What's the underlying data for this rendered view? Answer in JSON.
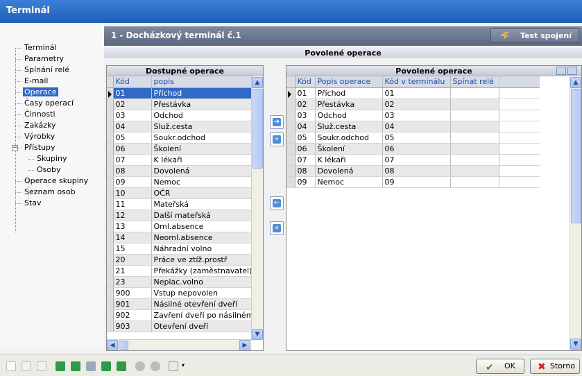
{
  "window": {
    "title": "Terminál"
  },
  "header": {
    "title": "1  -  Docházkový terminál č.1",
    "test_button": "Test spojení"
  },
  "section_title": "Povolené operace",
  "tree": [
    {
      "label": "Terminál",
      "level": 0
    },
    {
      "label": "Parametry",
      "level": 0
    },
    {
      "label": "Spínání relé",
      "level": 0
    },
    {
      "label": "E-mail",
      "level": 0
    },
    {
      "label": "Operace",
      "level": 0,
      "selected": true
    },
    {
      "label": "Časy operací",
      "level": 0
    },
    {
      "label": "Činnosti",
      "level": 0
    },
    {
      "label": "Zakázky",
      "level": 0
    },
    {
      "label": "Výrobky",
      "level": 0
    },
    {
      "label": "Přístupy",
      "level": 0,
      "expander": "−"
    },
    {
      "label": "Skupiny",
      "level": 1
    },
    {
      "label": "Osoby",
      "level": 1
    },
    {
      "label": "Operace skupiny",
      "level": 0
    },
    {
      "label": "Seznam osob",
      "level": 0
    },
    {
      "label": "Stav",
      "level": 0
    }
  ],
  "available": {
    "title": "Dostupné operace",
    "columns": [
      "Kód",
      "popis"
    ],
    "rows": [
      [
        "01",
        "Příchod"
      ],
      [
        "02",
        "Přestávka"
      ],
      [
        "03",
        "Odchod"
      ],
      [
        "04",
        "Služ.cesta"
      ],
      [
        "05",
        "Soukr.odchod"
      ],
      [
        "06",
        "Školení"
      ],
      [
        "07",
        "K lékaři"
      ],
      [
        "08",
        "Dovolená"
      ],
      [
        "09",
        "Nemoc"
      ],
      [
        "10",
        "OČR"
      ],
      [
        "11",
        "Mateřská"
      ],
      [
        "12",
        "Další mateřská"
      ],
      [
        "13",
        "Oml.absence"
      ],
      [
        "14",
        "Neoml.absence"
      ],
      [
        "15",
        "Náhradní volno"
      ],
      [
        "20",
        "Práce ve ztíž.prostř"
      ],
      [
        "21",
        "Překážky (zaměstnavatel)"
      ],
      [
        "23",
        "Neplac.volno"
      ],
      [
        "900",
        "Vstup nepovolen"
      ],
      [
        "901",
        "Násilné otevření dveří"
      ],
      [
        "902",
        "Zavření dveří po násilném"
      ],
      [
        "903",
        "Otevření dveří"
      ]
    ]
  },
  "allowed": {
    "title": "Povolené operace",
    "columns": [
      "Kód",
      "Popis operace",
      "Kód v terminálu",
      "Spínat relé"
    ],
    "rows": [
      [
        "01",
        "Příchod",
        "01",
        ""
      ],
      [
        "02",
        "Přestávka",
        "02",
        ""
      ],
      [
        "03",
        "Odchod",
        "03",
        ""
      ],
      [
        "04",
        "Služ.cesta",
        "04",
        ""
      ],
      [
        "05",
        "Soukr.odchod",
        "05",
        ""
      ],
      [
        "06",
        "Školení",
        "06",
        ""
      ],
      [
        "07",
        "K lékaři",
        "07",
        ""
      ],
      [
        "08",
        "Dovolená",
        "08",
        ""
      ],
      [
        "09",
        "Nemoc",
        "09",
        ""
      ]
    ]
  },
  "buttons": {
    "ok": "OK",
    "cancel": "Storno"
  },
  "colors": {
    "accent": "#3169c6",
    "title": "#2a6fd0",
    "header": "#6b7690"
  }
}
